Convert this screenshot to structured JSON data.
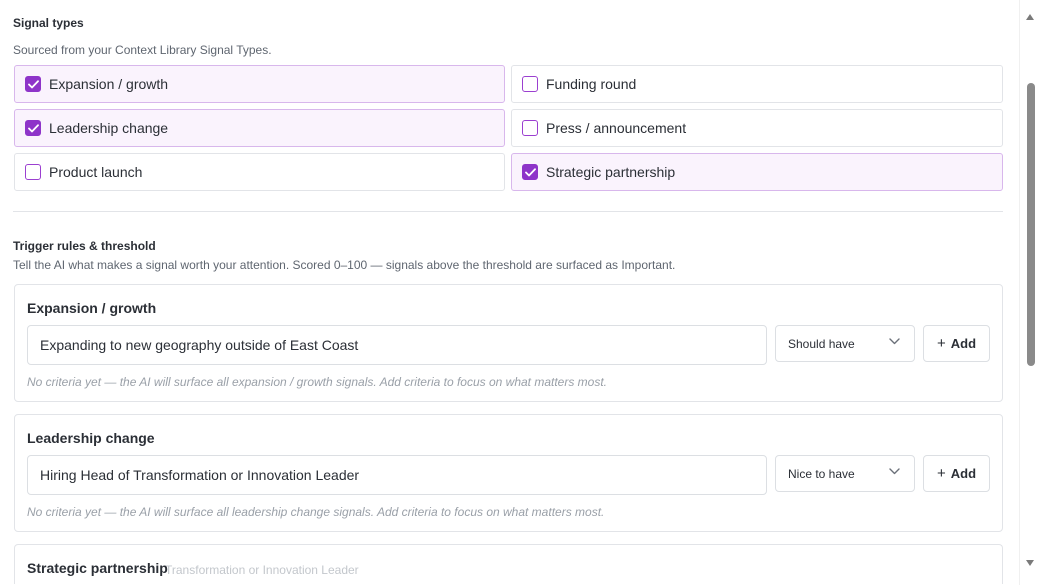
{
  "signal_types": {
    "title": "Signal types",
    "description": "Sourced from your Context Library Signal Types.",
    "options": [
      {
        "label": "Expansion / growth",
        "checked": true
      },
      {
        "label": "Funding round",
        "checked": false
      },
      {
        "label": "Leadership change",
        "checked": true
      },
      {
        "label": "Press / announcement",
        "checked": false
      },
      {
        "label": "Product launch",
        "checked": false
      },
      {
        "label": "Strategic partnership",
        "checked": true
      }
    ]
  },
  "trigger_rules": {
    "title": "Trigger rules & threshold",
    "description": "Tell the AI what makes a signal worth your attention. Scored 0–100 — signals above the threshold are surfaced as Important.",
    "rules": [
      {
        "title": "Expansion / growth",
        "input_value": "Expanding to new geography outside of East Coast",
        "priority": "Should have",
        "add_label": "Add",
        "hint": "No criteria yet — the AI will surface all expansion / growth signals. Add criteria to focus on what matters most."
      },
      {
        "title": "Leadership change",
        "input_value": "Hiring Head of Transformation or Innovation Leader",
        "priority": "Nice to have",
        "add_label": "Add",
        "hint": "No criteria yet — the AI will surface all leadership change signals. Add criteria to focus on what matters most."
      },
      {
        "title": "Strategic partnership",
        "ghost_text": "Transformation or Innovation Leader"
      }
    ]
  },
  "colors": {
    "accent": "#8e34c9",
    "checked_bg": "#faf3fd",
    "checked_border": "#d8b7ec"
  }
}
